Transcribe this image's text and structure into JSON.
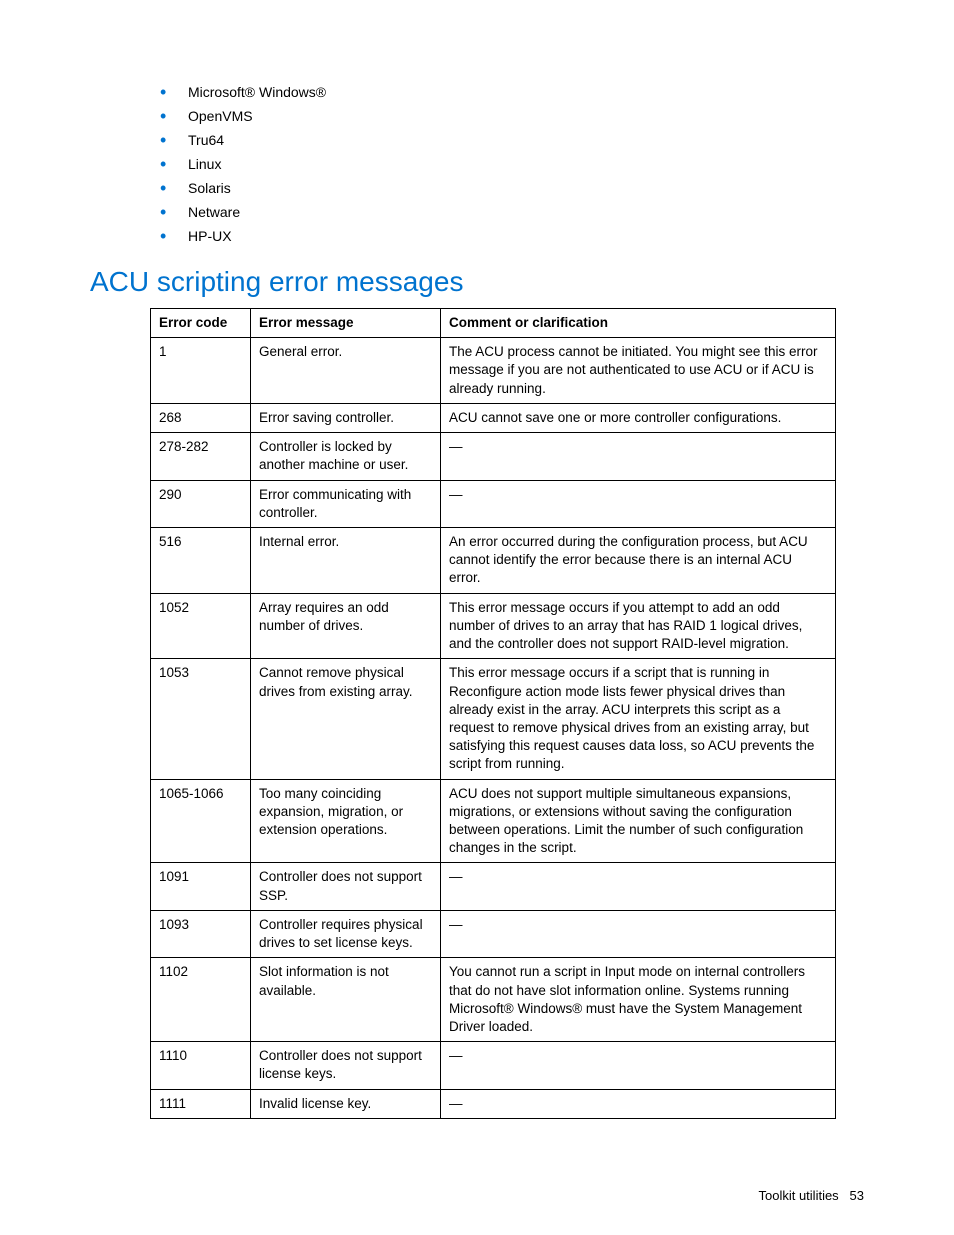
{
  "os_list": [
    "Microsoft® Windows®",
    "OpenVMS",
    "Tru64",
    "Linux",
    "Solaris",
    "Netware",
    "HP-UX"
  ],
  "heading": "ACU scripting error messages",
  "table": {
    "headers": {
      "code": "Error code",
      "message": "Error message",
      "comment": "Comment or clarification"
    },
    "rows": [
      {
        "code": "1",
        "message": "General error.",
        "comment": "The ACU process cannot be initiated. You might see this error message if you are not authenticated to use ACU or if ACU is already running."
      },
      {
        "code": "268",
        "message": "Error saving controller.",
        "comment": "ACU cannot save one or more controller configurations."
      },
      {
        "code": "278-282",
        "message": "Controller is locked by another machine or user.",
        "comment": "—"
      },
      {
        "code": "290",
        "message": "Error communicating with controller.",
        "comment": "—"
      },
      {
        "code": "516",
        "message": "Internal error.",
        "comment": "An error occurred during the configuration process, but ACU cannot identify the error because there is an internal ACU error."
      },
      {
        "code": "1052",
        "message": "Array requires an odd number of drives.",
        "comment": "This error message occurs if you attempt to add an odd number of drives to an array that has RAID 1 logical drives, and the controller does not support RAID-level migration."
      },
      {
        "code": "1053",
        "message": "Cannot remove physical drives from existing array.",
        "comment": "This error message occurs if a script that is running in Reconfigure action mode lists fewer physical drives than already exist in the array. ACU interprets this script as a request to remove physical drives from an existing array, but satisfying this request causes data loss, so ACU prevents the script from running."
      },
      {
        "code": "1065-1066",
        "message": "Too many coinciding expansion, migration, or extension operations.",
        "comment": "ACU does not support multiple simultaneous expansions, migrations, or extensions without saving the configuration between operations. Limit the number of such configuration changes in the script."
      },
      {
        "code": "1091",
        "message": "Controller does not support SSP.",
        "comment": "—"
      },
      {
        "code": "1093",
        "message": "Controller requires physical drives to set license keys.",
        "comment": "—"
      },
      {
        "code": "1102",
        "message": "Slot information is not available.",
        "comment": "You cannot run a script in Input mode on internal controllers that do not have slot information online. Systems running Microsoft® Windows® must have the System Management Driver loaded."
      },
      {
        "code": "1110",
        "message": "Controller does not support license keys.",
        "comment": "—"
      },
      {
        "code": "1111",
        "message": "Invalid license key.",
        "comment": "—"
      }
    ]
  },
  "footer": {
    "section": "Toolkit utilities",
    "page": "53"
  }
}
